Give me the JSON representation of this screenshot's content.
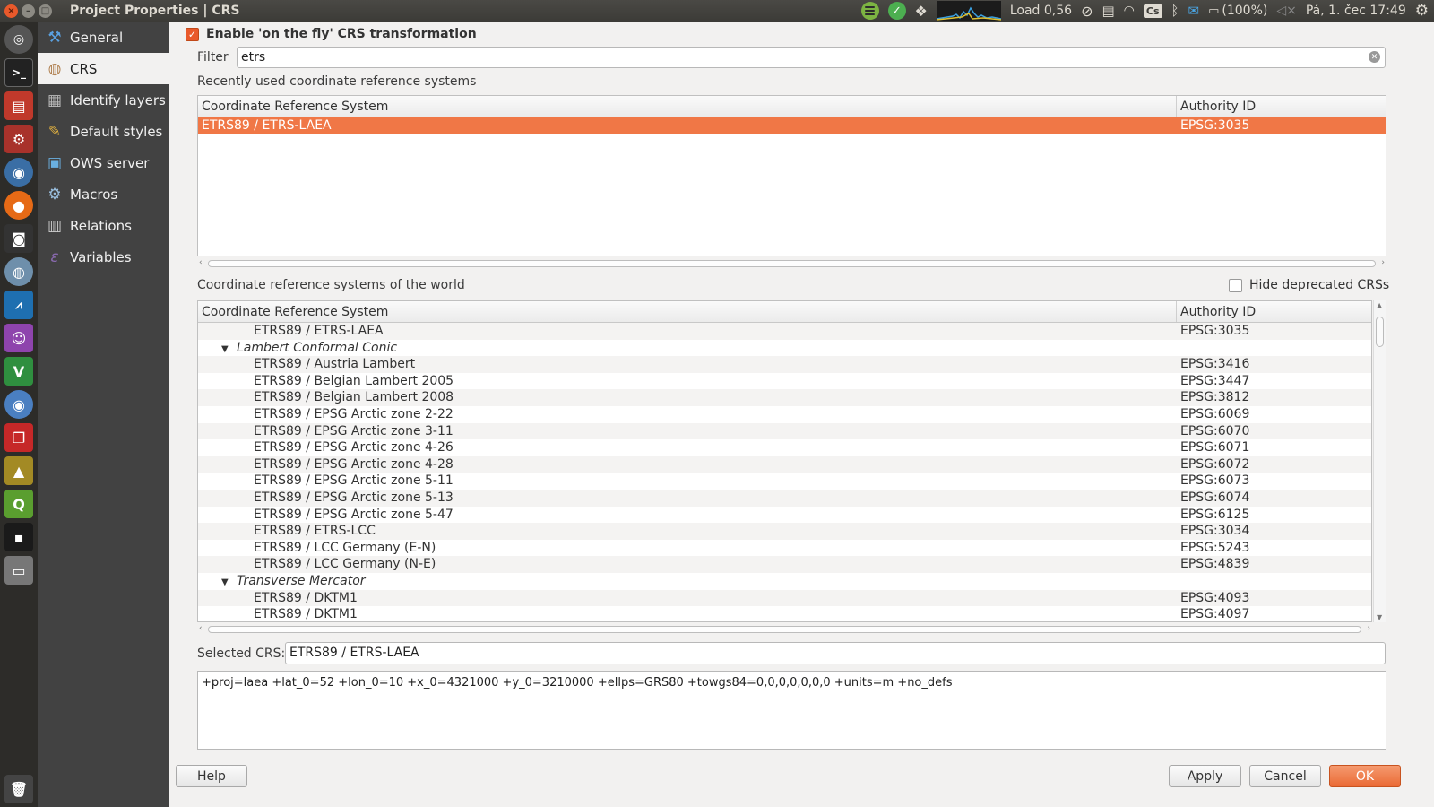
{
  "window": {
    "title": "Project Properties | CRS"
  },
  "tray": {
    "load": "Load 0,56",
    "keyboard": "Cs",
    "battery": "(100%)",
    "clock": "Pá, 1. čec 17:49",
    "icons": [
      "spotify-icon",
      "check-icon",
      "dropbox-icon",
      "system-monitor-graph",
      "sync-icon",
      "clipboard-icon",
      "wifi-icon",
      "keyboard-layout-icon",
      "bluetooth-icon",
      "mail-icon",
      "battery-icon",
      "volume-muted-icon",
      "gear-icon"
    ]
  },
  "launcher": {
    "icons": [
      "ubuntu-dash-icon",
      "terminal-icon",
      "files-icon",
      "settings-icon",
      "chromium-icon",
      "firefox-icon",
      "camera-icon",
      "network-icon",
      "monitor-icon",
      "pidgin-icon",
      "vim-icon",
      "chrome-icon",
      "pdf-icon",
      "vlc-icon",
      "qgis-icon",
      "dark-app-icon",
      "drive-icon",
      "trash-icon"
    ]
  },
  "sidebar": {
    "items": [
      {
        "label": "General",
        "icon": "tools-icon"
      },
      {
        "label": "CRS",
        "icon": "globe-icon"
      },
      {
        "label": "Identify layers",
        "icon": "identify-icon"
      },
      {
        "label": "Default styles",
        "icon": "brush-icon"
      },
      {
        "label": "OWS server",
        "icon": "server-icon"
      },
      {
        "label": "Macros",
        "icon": "macro-gear-icon"
      },
      {
        "label": "Relations",
        "icon": "relations-icon"
      },
      {
        "label": "Variables",
        "icon": "variable-icon"
      }
    ],
    "active_index": 1
  },
  "crs": {
    "otf_label": "Enable 'on the fly' CRS transformation",
    "otf_checked": true,
    "filter_label": "Filter",
    "filter_value": "etrs",
    "recent_label": "Recently used coordinate reference systems",
    "col_crs": "Coordinate Reference System",
    "col_auth": "Authority ID",
    "recent_rows": [
      {
        "name": "ETRS89 / ETRS-LAEA",
        "auth": "EPSG:3035",
        "selected": true
      }
    ],
    "world_label": "Coordinate reference systems of the world",
    "hide_deprecated_label": "Hide deprecated CRSs",
    "world_rows": [
      {
        "type": "leaf",
        "name": "ETRS89 / ETRS-LAEA",
        "auth": "EPSG:3035",
        "highlight": true
      },
      {
        "type": "group",
        "name": "Lambert Conformal Conic",
        "auth": ""
      },
      {
        "type": "leaf",
        "name": "ETRS89 / Austria Lambert",
        "auth": "EPSG:3416"
      },
      {
        "type": "leaf",
        "name": "ETRS89 / Belgian Lambert 2005",
        "auth": "EPSG:3447"
      },
      {
        "type": "leaf",
        "name": "ETRS89 / Belgian Lambert 2008",
        "auth": "EPSG:3812"
      },
      {
        "type": "leaf",
        "name": "ETRS89 / EPSG Arctic zone 2-22",
        "auth": "EPSG:6069"
      },
      {
        "type": "leaf",
        "name": "ETRS89 / EPSG Arctic zone 3-11",
        "auth": "EPSG:6070"
      },
      {
        "type": "leaf",
        "name": "ETRS89 / EPSG Arctic zone 4-26",
        "auth": "EPSG:6071"
      },
      {
        "type": "leaf",
        "name": "ETRS89 / EPSG Arctic zone 4-28",
        "auth": "EPSG:6072"
      },
      {
        "type": "leaf",
        "name": "ETRS89 / EPSG Arctic zone 5-11",
        "auth": "EPSG:6073"
      },
      {
        "type": "leaf",
        "name": "ETRS89 / EPSG Arctic zone 5-13",
        "auth": "EPSG:6074"
      },
      {
        "type": "leaf",
        "name": "ETRS89 / EPSG Arctic zone 5-47",
        "auth": "EPSG:6125"
      },
      {
        "type": "leaf",
        "name": "ETRS89 / ETRS-LCC",
        "auth": "EPSG:3034"
      },
      {
        "type": "leaf",
        "name": "ETRS89 / LCC Germany (E-N)",
        "auth": "EPSG:5243"
      },
      {
        "type": "leaf",
        "name": "ETRS89 / LCC Germany (N-E)",
        "auth": "EPSG:4839"
      },
      {
        "type": "group",
        "name": "Transverse Mercator",
        "auth": ""
      },
      {
        "type": "leaf",
        "name": "ETRS89 / DKTM1",
        "auth": "EPSG:4093"
      },
      {
        "type": "leaf",
        "name": "ETRS89 / DKTM1",
        "auth": "EPSG:4097"
      }
    ],
    "selected_label": "Selected CRS:",
    "selected_value": "ETRS89 / ETRS-LAEA",
    "proj_string": "+proj=laea +lat_0=52 +lon_0=10 +x_0=4321000 +y_0=3210000 +ellps=GRS80 +towgs84=0,0,0,0,0,0,0 +units=m +no_defs"
  },
  "buttons": {
    "help": "Help",
    "apply": "Apply",
    "cancel": "Cancel",
    "ok": "OK"
  }
}
